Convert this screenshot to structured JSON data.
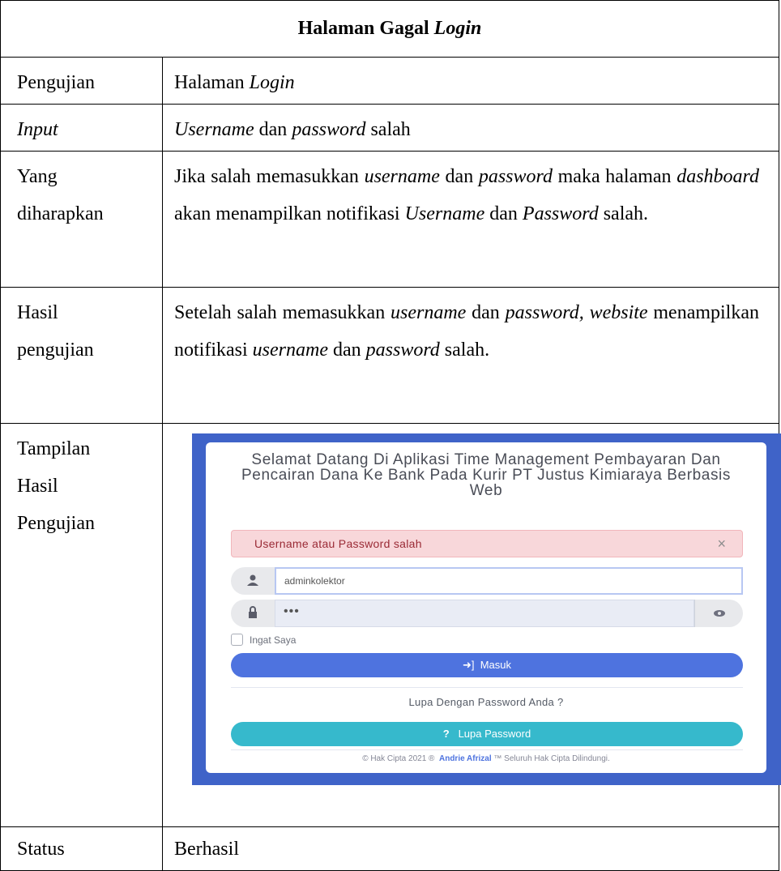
{
  "table": {
    "title_main": "Halaman Gagal ",
    "title_italic": "Login",
    "rows": {
      "pengujian": {
        "label": "Pengujian",
        "value_plain": "Halaman ",
        "value_italic": "Login"
      },
      "input": {
        "label": "Input",
        "v1": "Username",
        "v2": " dan ",
        "v3": "password",
        "v4": " salah"
      },
      "yang": {
        "label1": "Yang",
        "label2": "diharapkan",
        "t1": "Jika salah memasukkan ",
        "t2": "username",
        "t3": " dan ",
        "t4": "password",
        "t5": " maka halaman ",
        "t6": "dashboard",
        "t7": " akan menampilkan notifikasi ",
        "t8": "Username",
        "t9": " dan ",
        "t10": "Password",
        "t11": " salah."
      },
      "hasil": {
        "label1": "Hasil",
        "label2": "pengujian",
        "t1": "Setelah salah memasukkan ",
        "t2": "username",
        "t3": " dan ",
        "t4": "password,",
        "t5": " ",
        "t6": "website",
        "t7": " menampilkan notifikasi ",
        "t8": "username",
        "t9": " dan ",
        "t10": "password",
        "t11": " salah."
      },
      "tampilan": {
        "label1": "Tampilan",
        "label2": "Hasil",
        "label3": "Pengujian"
      },
      "status": {
        "label": "Status",
        "value": "Berhasil"
      }
    }
  },
  "login": {
    "title": "Selamat Datang Di Aplikasi Time Management Pembayaran Dan Pencairan Dana Ke Bank Pada Kurir PT Justus Kimiaraya Berbasis Web",
    "alert": "Username atau Password salah",
    "alert_close": "×",
    "username_value": "adminkolektor",
    "password_value": "•••",
    "remember": "Ingat Saya",
    "login_button": "Masuk",
    "forgot_text": "Lupa Dengan Password Anda ?",
    "forgot_button": "Lupa Password",
    "copyright_pre": "© Hak Cipta 2021 ®",
    "copyright_name": "Andrie Afrizal",
    "copyright_post": "™ Seluruh Hak Cipta Dilindungi.",
    "icons": [
      "user-icon",
      "lock-icon",
      "eye-icon",
      "sign-in-icon",
      "question-icon"
    ],
    "colors": {
      "background": "#3f63c8",
      "primary": "#4e73df",
      "info": "#36b9cc",
      "alert_bg": "#f8d7da"
    }
  }
}
